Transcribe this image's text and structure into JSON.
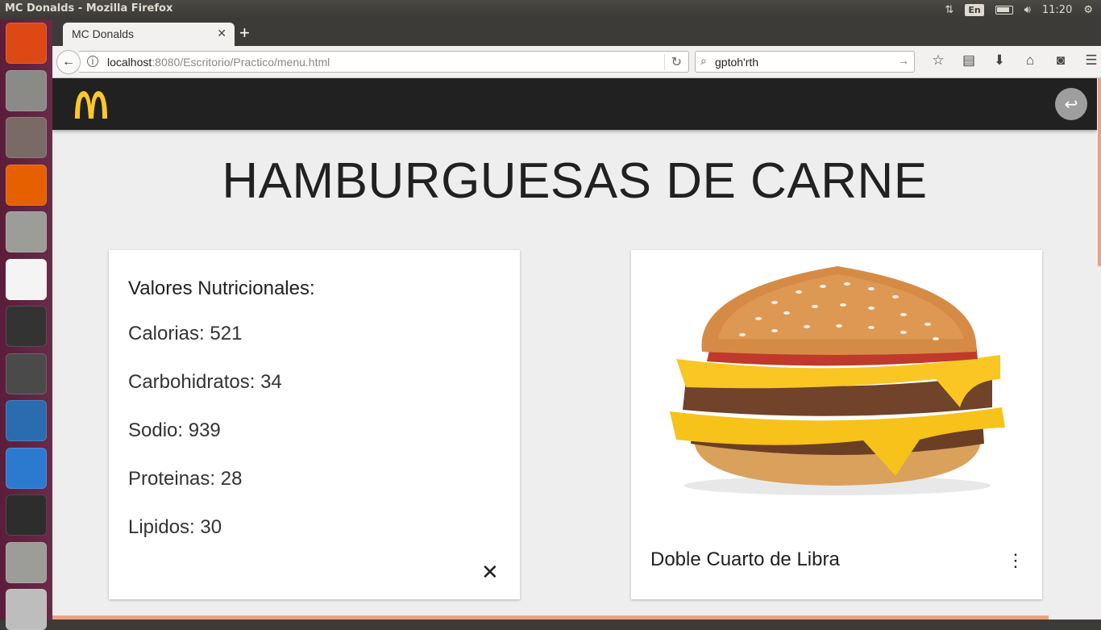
{
  "os": {
    "window_title": "MC Donalds - Mozilla Firefox",
    "keyboard_layout": "En",
    "clock": "11:20"
  },
  "launcher": [
    {
      "name": "ubuntu-dash-icon",
      "color": "#dd4814"
    },
    {
      "name": "files-icon",
      "color": "#8a8a86"
    },
    {
      "name": "system-settings-icon",
      "color": "#7a6a66"
    },
    {
      "name": "firefox-icon",
      "color": "#e66000"
    },
    {
      "name": "drive-icon",
      "color": "#9c9c98"
    },
    {
      "name": "java-icon",
      "color": "#f4f4f4"
    },
    {
      "name": "inkscape-icon",
      "color": "#333333"
    },
    {
      "name": "sublime-text-icon",
      "color": "#4a4a4a"
    },
    {
      "name": "libreoffice-writer-icon",
      "color": "#2b6cb0"
    },
    {
      "name": "brackets-icon",
      "color": "#2c7ad0"
    },
    {
      "name": "terminal-icon",
      "color": "#2d2d2d"
    },
    {
      "name": "drive-icon-2",
      "color": "#9c9c98"
    },
    {
      "name": "trash-icon",
      "color": "#bdbdbd"
    }
  ],
  "browser": {
    "tab_title": "MC Donalds",
    "url_host": "localhost",
    "url_rest": ":8080/Escritorio/Practico/menu.html",
    "search_value": "gptoh'rth"
  },
  "page": {
    "heading": "HAMBURGUESAS DE CARNE",
    "nutrition_title": "Valores Nutricionales:",
    "nutrition": [
      "Calorias: 521",
      "Carbohidratos: 34",
      "Sodio: 939",
      "Proteinas: 28",
      "Lipidos: 30"
    ],
    "product_name": "Doble Cuarto de Libra"
  },
  "colors": {
    "appbar": "#212121",
    "brand_yellow": "#ffc72c",
    "accent": "#f0a080"
  }
}
